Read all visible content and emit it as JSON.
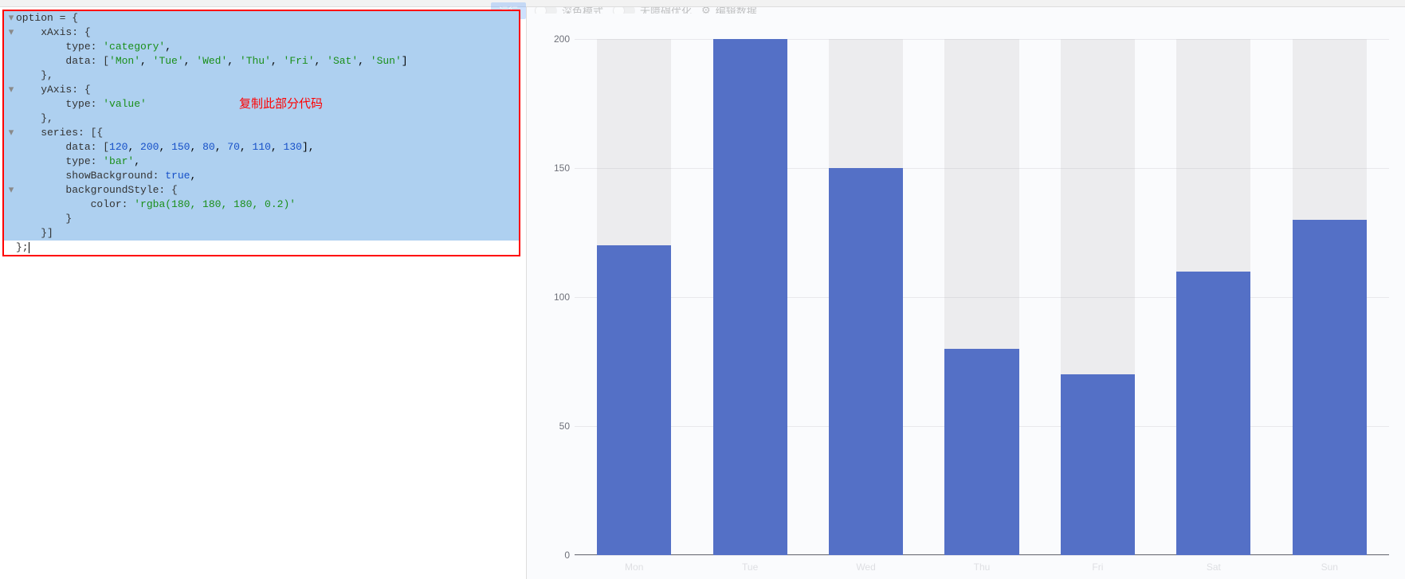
{
  "annotation": "复制此部分代码",
  "toolbar": {
    "run_label": "运行",
    "dark_label": "深色模式",
    "render_label": "无障碍优化",
    "download_label": "编辑数据"
  },
  "code": {
    "l1": "option = {",
    "l2": "    xAxis: {",
    "l3": "        type: ",
    "l3s": "'category'",
    "l3e": ",",
    "l4": "        data: [",
    "l4a": "'Mon'",
    "l4b": "'Tue'",
    "l4c": "'Wed'",
    "l4d": "'Thu'",
    "l4e": "'Fri'",
    "l4f": "'Sat'",
    "l4g": "'Sun'",
    "l4z": "]",
    "l5": "    },",
    "l6": "    yAxis: {",
    "l7": "        type: ",
    "l7s": "'value'",
    "l8": "    },",
    "l9": "    series: [{",
    "l10": "        data: [",
    "l10a": "120",
    "l10b": "200",
    "l10c": "150",
    "l10d": "80",
    "l10e": "70",
    "l10f": "110",
    "l10g": "130",
    "l10z": "],",
    "l11": "        type: ",
    "l11s": "'bar'",
    "l11e": ",",
    "l12": "        showBackground: ",
    "l12b": "true",
    "l12e": ",",
    "l13": "        backgroundStyle: {",
    "l14": "            color: ",
    "l14s": "'rgba(180, 180, 180, 0.2)'",
    "l15": "        }",
    "l16": "    }]",
    "l17": "};"
  },
  "chart_data": {
    "type": "bar",
    "categories": [
      "Mon",
      "Tue",
      "Wed",
      "Thu",
      "Fri",
      "Sat",
      "Sun"
    ],
    "values": [
      120,
      200,
      150,
      80,
      70,
      110,
      130
    ],
    "title": "",
    "xlabel": "",
    "ylabel": "",
    "ylim": [
      0,
      200
    ],
    "yticks": [
      0,
      50,
      100,
      150,
      200
    ],
    "showBackground": true,
    "backgroundColor": "rgba(180, 180, 180, 0.2)",
    "barColor": "#5470c6"
  }
}
